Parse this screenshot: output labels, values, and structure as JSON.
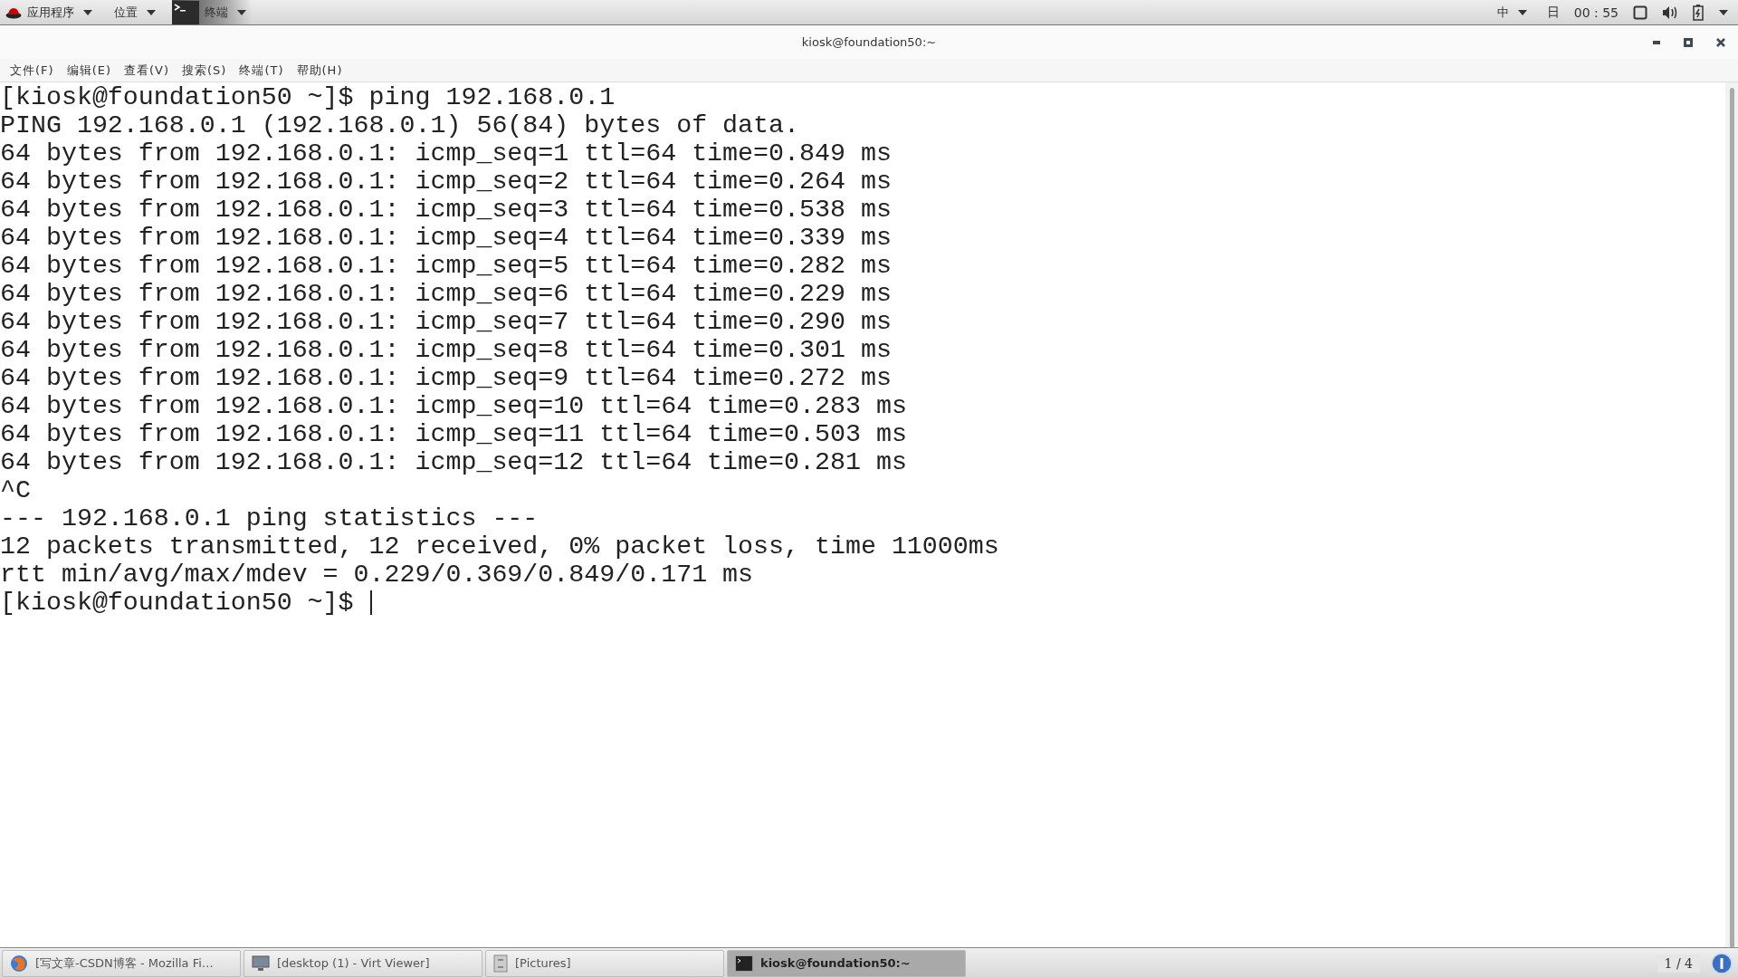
{
  "top_bar": {
    "apps_menu": "应用程序",
    "places_menu": "位置",
    "active_app": "终端",
    "input_method": "中",
    "day": "日",
    "clock": "00 : 55"
  },
  "window": {
    "title": "kiosk@foundation50:~"
  },
  "menu": [
    "文件(F)",
    "编辑(E)",
    "查看(V)",
    "搜索(S)",
    "终端(T)",
    "帮助(H)"
  ],
  "terminal": {
    "lines": [
      "[kiosk@foundation50 ~]$ ping 192.168.0.1",
      "PING 192.168.0.1 (192.168.0.1) 56(84) bytes of data.",
      "64 bytes from 192.168.0.1: icmp_seq=1 ttl=64 time=0.849 ms",
      "64 bytes from 192.168.0.1: icmp_seq=2 ttl=64 time=0.264 ms",
      "64 bytes from 192.168.0.1: icmp_seq=3 ttl=64 time=0.538 ms",
      "64 bytes from 192.168.0.1: icmp_seq=4 ttl=64 time=0.339 ms",
      "64 bytes from 192.168.0.1: icmp_seq=5 ttl=64 time=0.282 ms",
      "64 bytes from 192.168.0.1: icmp_seq=6 ttl=64 time=0.229 ms",
      "64 bytes from 192.168.0.1: icmp_seq=7 ttl=64 time=0.290 ms",
      "64 bytes from 192.168.0.1: icmp_seq=8 ttl=64 time=0.301 ms",
      "64 bytes from 192.168.0.1: icmp_seq=9 ttl=64 time=0.272 ms",
      "64 bytes from 192.168.0.1: icmp_seq=10 ttl=64 time=0.283 ms",
      "64 bytes from 192.168.0.1: icmp_seq=11 ttl=64 time=0.503 ms",
      "64 bytes from 192.168.0.1: icmp_seq=12 ttl=64 time=0.281 ms",
      "^C",
      "--- 192.168.0.1 ping statistics ---",
      "12 packets transmitted, 12 received, 0% packet loss, time 11000ms",
      "rtt min/avg/max/mdev = 0.229/0.369/0.849/0.171 ms"
    ],
    "prompt": "[kiosk@foundation50 ~]$"
  },
  "taskbar": {
    "tasks": [
      {
        "kind": "browser",
        "label": "[写文章-CSDN博客 - Mozilla Fi…",
        "selected": false
      },
      {
        "kind": "viewer",
        "label": "[desktop (1) - Virt Viewer]",
        "selected": false
      },
      {
        "kind": "files",
        "label": "[Pictures]",
        "selected": false
      },
      {
        "kind": "terminal",
        "label": "kiosk@foundation50:~",
        "selected": true
      }
    ],
    "workspace": "1 / 4"
  }
}
